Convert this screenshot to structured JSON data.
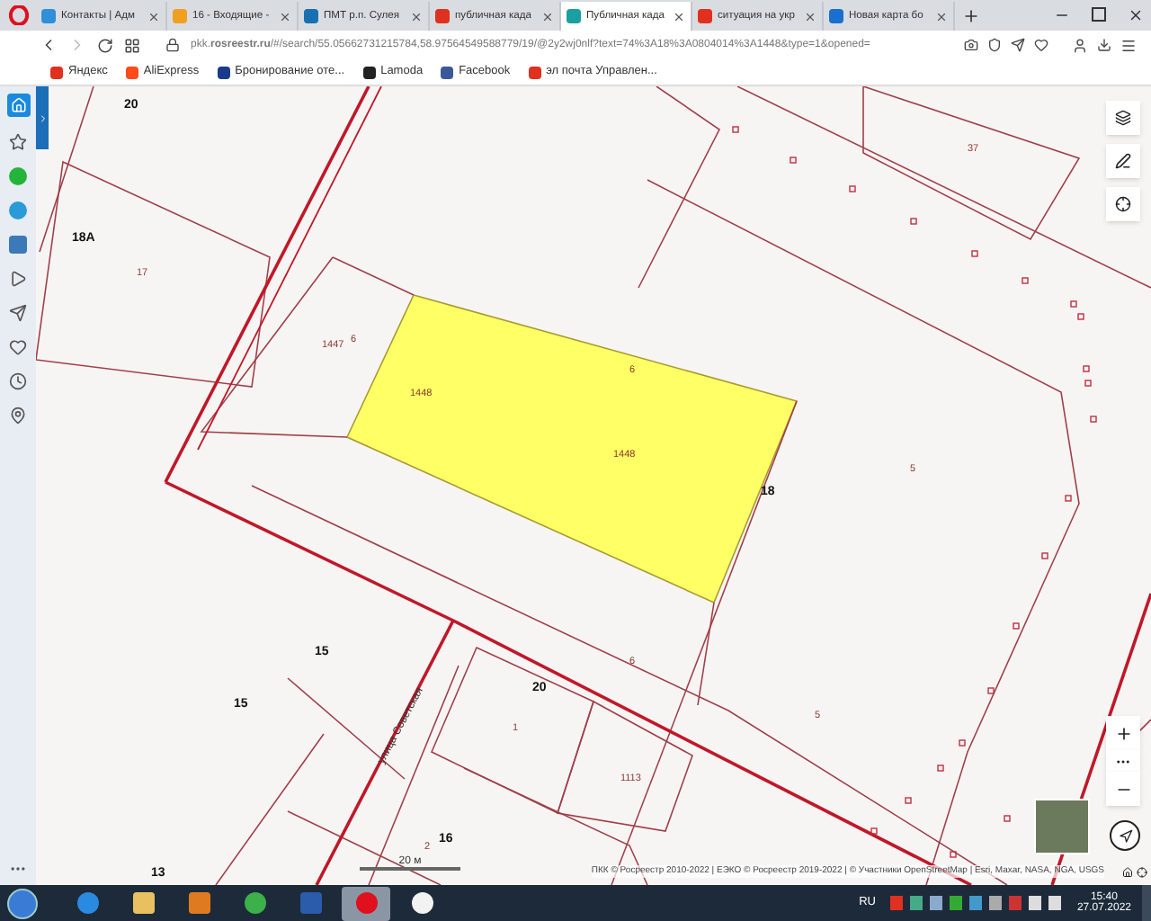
{
  "browser": {
    "tabs": [
      {
        "title": "Контакты | Адм",
        "selected": false
      },
      {
        "title": "16 - Входящие -",
        "selected": false
      },
      {
        "title": "ПМТ р.п. Сулея",
        "selected": false
      },
      {
        "title": "публичная када",
        "selected": false
      },
      {
        "title": "Публичная када",
        "selected": true
      },
      {
        "title": "ситуация на укр",
        "selected": false
      },
      {
        "title": "Новая карта бо",
        "selected": false
      }
    ],
    "address": "pkk.**rosreestr.ru**/#/search/55.05662731215784,58.97564549588779/19/@2y2wj0nlf?text=74%3A18%3A0804014%3A1448&type=1&opened=",
    "bookmarks": [
      "Яндекс",
      "AliExpress",
      "Бронирование оте...",
      "Lamoda",
      "Facebook",
      "эл почта Управлен..."
    ]
  },
  "map": {
    "labels": [
      {
        "text": "20",
        "kind": "house"
      },
      {
        "text": "18А",
        "kind": "house"
      },
      {
        "text": "17",
        "kind": "parcel"
      },
      {
        "text": "37",
        "kind": "parcel"
      },
      {
        "text": "1447",
        "kind": "parcel"
      },
      {
        "text": "6",
        "kind": "parcel"
      },
      {
        "text": "1448",
        "kind": "parcel"
      },
      {
        "text": "6",
        "kind": "parcel"
      },
      {
        "text": "1448",
        "kind": "parcel"
      },
      {
        "text": "18",
        "kind": "house"
      },
      {
        "text": "5",
        "kind": "parcel"
      },
      {
        "text": "15",
        "kind": "house"
      },
      {
        "text": "20",
        "kind": "house"
      },
      {
        "text": "6",
        "kind": "parcel"
      },
      {
        "text": "15",
        "kind": "house"
      },
      {
        "text": "5",
        "kind": "parcel"
      },
      {
        "text": "1",
        "kind": "parcel"
      },
      {
        "text": "1113",
        "kind": "parcel"
      },
      {
        "text": "улица Советская",
        "kind": "street"
      },
      {
        "text": "2",
        "kind": "parcel"
      },
      {
        "text": "16",
        "kind": "house"
      },
      {
        "text": "13",
        "kind": "house"
      }
    ],
    "scale": "20 м",
    "attribution": "ПКК © Росреестр 2010-2022 | ЕЭКО © Росреестр 2019-2022 | © Участники OpenStreetMap | Esri, Maxar, NASA, NGA, USGS"
  },
  "taskbar": {
    "apps": [
      {
        "selected": false
      },
      {
        "selected": false
      },
      {
        "selected": false
      },
      {
        "selected": false
      },
      {
        "selected": false
      },
      {
        "selected": true
      },
      {
        "selected": false
      }
    ],
    "language": "RU",
    "time": "15:40",
    "date": "27.07.2022"
  }
}
